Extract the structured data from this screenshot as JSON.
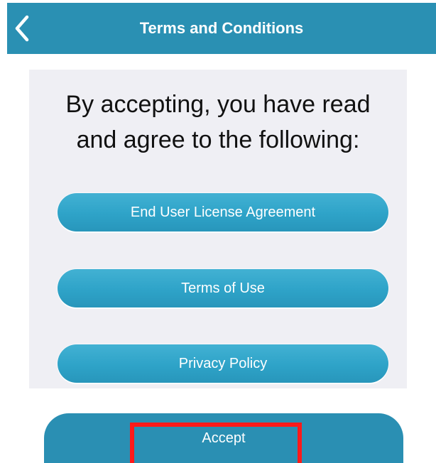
{
  "nav": {
    "title": "Terms and Conditions",
    "back_icon": "chevron-left-icon"
  },
  "content": {
    "intro_line1": "By accepting, you have read",
    "intro_line2": "and agree to the following:",
    "links": [
      {
        "label": "End User License Agreement"
      },
      {
        "label": "Terms of Use"
      },
      {
        "label": "Privacy Policy"
      }
    ]
  },
  "footer": {
    "accept_label": "Accept"
  },
  "colors": {
    "nav_background": "#2a90b3",
    "panel_background": "#efeff4",
    "button_accent": "#2ea3c8",
    "highlight_border": "#ff1a1a"
  }
}
